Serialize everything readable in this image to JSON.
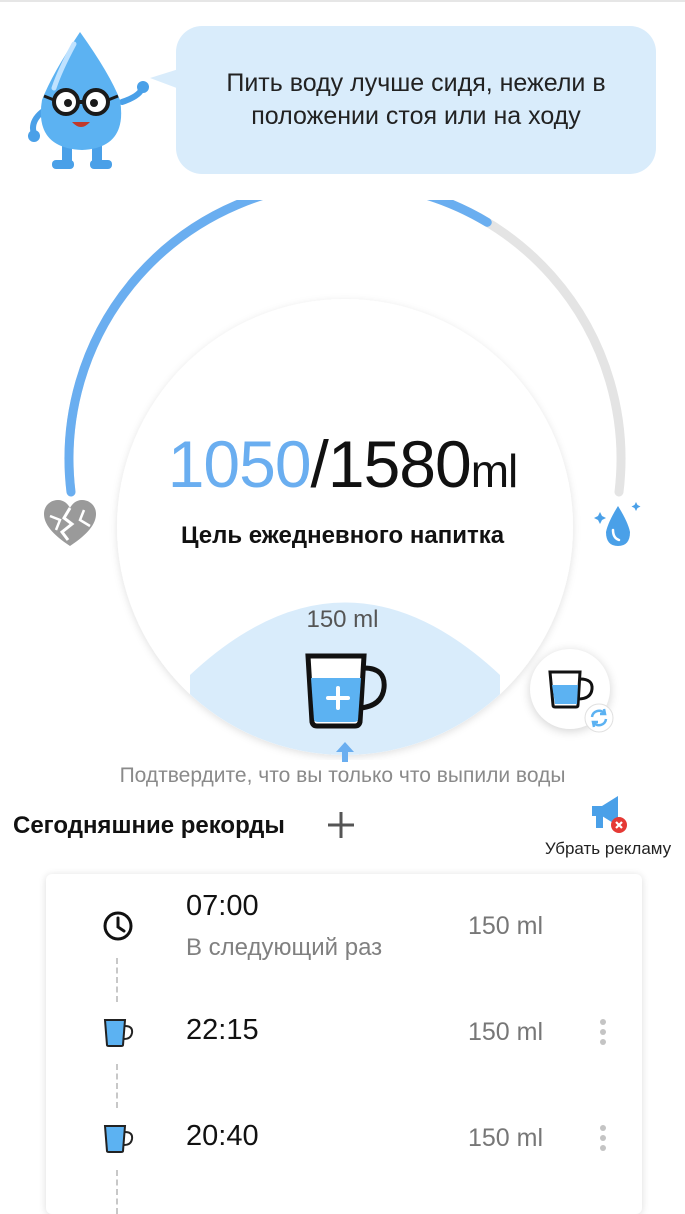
{
  "tip": {
    "text": "Пить воду лучше сидя, нежели в положении стоя или на ходу"
  },
  "progress": {
    "current": "1050",
    "separator": "/",
    "goal": "1580",
    "unit": "ml",
    "fraction": 0.66,
    "goal_label": "Цель ежедневного напитка"
  },
  "cup": {
    "amount_label": "150 ml",
    "confirm_hint": "Подтвердите, что вы только что выпили воды"
  },
  "records": {
    "title": "Сегодняшние рекорды",
    "remove_ads_label": "Убрать рекламу",
    "items": [
      {
        "time": "07:00",
        "subtitle": "В следующий раз",
        "amount": "150 ml",
        "icon": "clock-icon"
      },
      {
        "time": "22:15",
        "amount": "150 ml",
        "icon": "cup-icon"
      },
      {
        "time": "20:40",
        "amount": "150 ml",
        "icon": "cup-icon"
      }
    ]
  },
  "colors": {
    "accent": "#6aaef0",
    "water_light": "#d9ecfb",
    "track": "#e4e4e4"
  }
}
